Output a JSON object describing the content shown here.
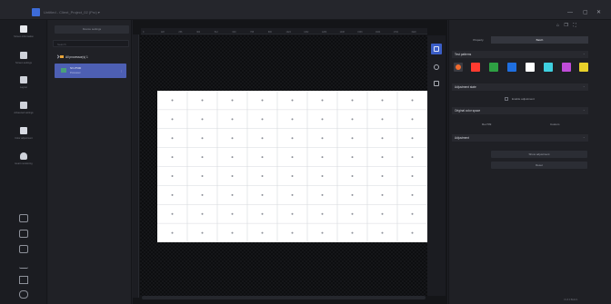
{
  "app": {
    "title": "Untitled - Client_Project_02 (Pro) ▾",
    "accent_color": "#3d6bd8",
    "window_controls": [
      "—",
      "▢",
      "✕"
    ]
  },
  "left_sidebar": {
    "items": [
      {
        "label": "Screen information",
        "icon": "list-icon",
        "active": true
      },
      {
        "label": "Screen settings",
        "icon": "grid-icon"
      },
      {
        "label": "Layout",
        "icon": "layout-icon"
      },
      {
        "label": "Advanced settings",
        "icon": "advanced-settings-icon"
      },
      {
        "label": "Color adjustment",
        "icon": "color-adjust-icon"
      },
      {
        "label": "Heart monitoring",
        "icon": "heart-icon"
      }
    ],
    "bottom_icons": [
      "add-icon",
      "calendar-icon",
      "display-icon",
      "bar-chart-icon",
      "sitemap-icon",
      "chat-icon"
    ]
  },
  "tree_panel": {
    "header_button_label": "Device settings",
    "search_placeholder": "Search",
    "root_label": "All processor(s) 1",
    "selected_item": {
      "title": "NX-P500",
      "subtitle": "Processor"
    }
  },
  "canvas": {
    "grid_columns": 9,
    "grid_rows": 8,
    "board_color": "#ffffff",
    "ruler_marks": [
      "0",
      "128",
      "256",
      "384",
      "512",
      "640",
      "768",
      "896",
      "1024",
      "1152",
      "1280",
      "1408",
      "1536",
      "1664",
      "1792",
      "1920"
    ]
  },
  "right_panel": {
    "tabs": [
      "Property",
      "Batch"
    ],
    "sections": {
      "test_patterns": "Test patterns",
      "adjustment_state": "Adjustment state",
      "original_color_space": "Original color space",
      "adjustment": "Adjustment"
    },
    "test_pattern_colors": [
      "#ff3b30",
      "#2ea043",
      "#1f6fe0",
      "#ffffff",
      "#3fd0e0",
      "#c04cd8",
      "#e8d12a"
    ],
    "enable_adjustment_label": "Enable adjustment",
    "color_space_options": [
      "Rec709",
      "Custom"
    ],
    "adjustment_buttons": [
      "Show adjustment",
      "Reset"
    ]
  },
  "status": {
    "text": "V1.8.0 Build 1"
  }
}
